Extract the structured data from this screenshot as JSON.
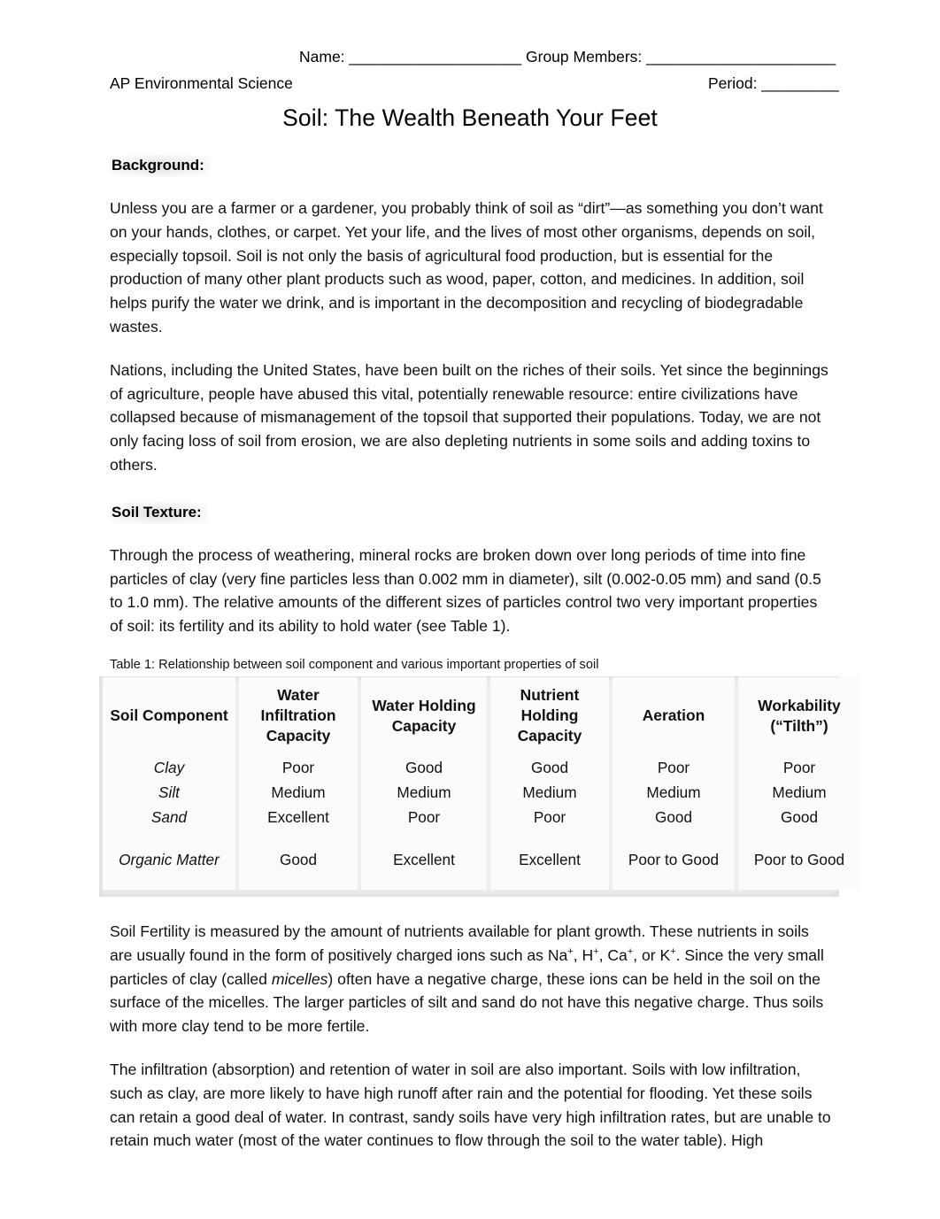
{
  "header": {
    "name_label": "Name: ____________________",
    "group_label": "Group Members: ______________________",
    "course": "AP Environmental Science",
    "period_label": "Period: _________"
  },
  "title": "Soil: The Wealth Beneath Your Feet",
  "sections": {
    "background": {
      "heading": "Background:",
      "paragraph1": "Unless you are a farmer or a gardener, you probably think of soil as “dirt”—as something you don’t want on your hands, clothes, or carpet. Yet your life, and the lives of most other organisms, depends on soil, especially topsoil. Soil is not only the basis of agricultural food production, but is essential for the production of many other plant products such as wood, paper, cotton, and medicines. In addition, soil helps purify the water we drink, and is important in the decomposition and recycling of biodegradable wastes.",
      "paragraph2": "Nations, including the United States, have been built on the riches of their soils. Yet since the beginnings of agriculture, people have abused this vital, potentially renewable resource: entire civilizations have collapsed because of mismanagement of the topsoil that supported their populations. Today, we are not only facing loss of soil from erosion, we are also depleting nutrients in some soils and adding toxins to others."
    },
    "soil_texture": {
      "heading": "Soil Texture:",
      "paragraph1": "Through the process of weathering, mineral rocks are broken down over long periods of time into fine particles of clay (very fine particles less than 0.002 mm in diameter), silt (0.002-0.05 mm) and sand (0.5 to 1.0 mm). The relative amounts of the different sizes of particles control two very important properties of soil: its fertility and its ability to hold water (see Table 1)."
    }
  },
  "table": {
    "caption": "Table 1: Relationship between soil component and various important properties of soil",
    "headers": [
      "Soil Component",
      "Water Infiltration Capacity",
      "Water Holding Capacity",
      "Nutrient Holding Capacity",
      "Aeration",
      "Workability (“Tilth”)"
    ],
    "rows": [
      {
        "component": "Clay",
        "values": [
          "Poor",
          "Good",
          "Good",
          "Poor",
          "Poor"
        ]
      },
      {
        "component": "Silt",
        "values": [
          "Medium",
          "Medium",
          "Medium",
          "Medium",
          "Medium"
        ]
      },
      {
        "component": "Sand",
        "values": [
          "Excellent",
          "Poor",
          "Poor",
          "Good",
          "Good"
        ]
      },
      {
        "component": "Organic Matter",
        "values": [
          "Good",
          "Excellent",
          "Excellent",
          "Poor to Good",
          "Poor to Good"
        ]
      }
    ]
  },
  "fertility": {
    "part1": "Soil Fertility is measured by the amount of nutrients available for plant growth. These nutrients in soils are usually found in the form of positively charged ions such as Na",
    "sup1": "+",
    "part2": ", H",
    "sup2": "+",
    "part3": ", Ca",
    "sup3": "+",
    "part4": ", or K",
    "sup4": "+",
    "part5": ". Since the very small particles of clay (called ",
    "italic_word": "micelles",
    "part6": ") often have a negative charge, these ions can be held in the soil on the surface of the micelles. The larger particles of silt and sand do not have this negative charge. Thus soils with more clay tend to be more fertile."
  },
  "infiltration": {
    "paragraph": "The infiltration (absorption) and retention of water in soil are also important. Soils with low infiltration, such as clay, are more likely to have high runoff after rain and the potential for flooding. Yet these soils can retain a good deal of water. In contrast, sandy soils have very high infiltration rates, but are unable to retain much water (most of the water continues to flow through the soil to the water table). High"
  },
  "colors": {
    "page_background": "#ffffff",
    "text": "#111111",
    "table_background": "#efefef",
    "table_cell": "#fbfbfb",
    "heading_highlight": "#dedede"
  }
}
